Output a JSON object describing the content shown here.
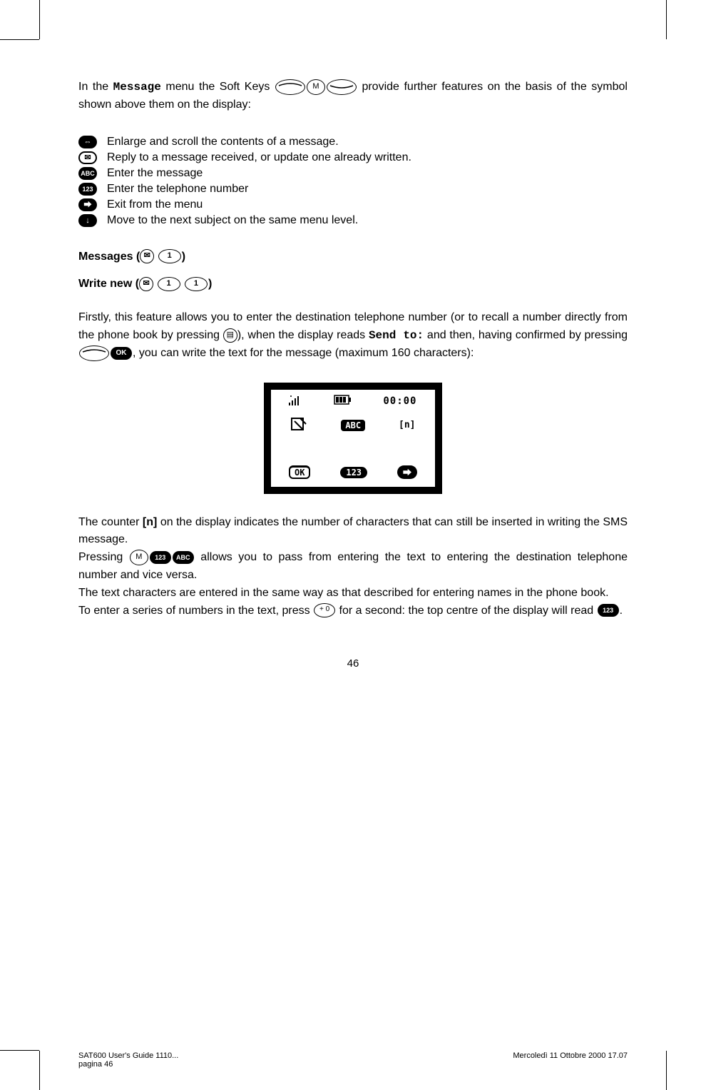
{
  "p1a": "In the ",
  "p1b": "Message",
  "p1c": " menu the Soft Keys ",
  "p1d": " provide further features on the basis of the symbol shown above them on the display:",
  "icons": {
    "scroll": "Enlarge and scroll the contents of a message.",
    "reply": "Reply to a message received, or update one already written.",
    "abc": "Enter the message",
    "num": "Enter the telephone number",
    "exit": "Exit from the menu",
    "down": "Move to the next subject on the same menu level.",
    "abc_label": "ABC",
    "num_label": "123"
  },
  "h_messages": "Messages (",
  "h_messages_end": ")",
  "h_write": "Write new (",
  "h_write_end": ")",
  "p2a": "Firstly, this feature allows you to enter the destination telephone number (or to recall a number directly from the phone book by pressing ",
  "p2b": "), when the display reads ",
  "p2c": "Send to:",
  "p2d": " and then, having confirmed by pressing ",
  "p2e": ", you can write the text for the message (maximum 160 characters):",
  "ok_label": "OK",
  "screen": {
    "time": "00:00",
    "abc": "ABC",
    "n": "[n]",
    "ok": "OK",
    "num": "123"
  },
  "p3": "The counter [n] on the display indicates the number of characters that can still be inserted in writing the SMS message.",
  "p3_pre": "The counter ",
  "p3_n": "[n]",
  "p3_post": " on the display indicates the number of characters that can still be inserted in writing the SMS message.",
  "p4a": "Pressing ",
  "p4b": " allows you to pass from entering the text to entering the destination telephone number and vice versa.",
  "p5": "The text characters are entered in the same way as that described for entering names in the phone book.",
  "p6a": "To enter a series of numbers in the text, press ",
  "p6b": " for a second: the top centre of the display will read ",
  "p6c": ".",
  "pagenum": "46",
  "footer_left1": "SAT600 User's Guide 1110...",
  "footer_left2": "pagina 46",
  "footer_right": "Mercoledì 11 Ottobre 2000 17.07",
  "key_m": "M",
  "key_1": "1",
  "key_0": "0",
  "key_envelope": "✉",
  "key_book": "📖"
}
